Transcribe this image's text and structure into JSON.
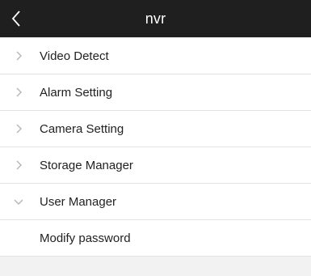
{
  "header": {
    "title": "nvr",
    "back_icon": "chevron-left-icon"
  },
  "menu": {
    "items": [
      {
        "label": "Video Detect",
        "icon": "chevron-right-icon",
        "expanded": false
      },
      {
        "label": "Alarm Setting",
        "icon": "chevron-right-icon",
        "expanded": false
      },
      {
        "label": "Camera Setting",
        "icon": "chevron-right-icon",
        "expanded": false
      },
      {
        "label": "Storage Manager",
        "icon": "chevron-right-icon",
        "expanded": false
      },
      {
        "label": "User Manager",
        "icon": "chevron-down-icon",
        "expanded": true
      }
    ],
    "subitems": [
      {
        "label": "Modify password"
      }
    ]
  },
  "colors": {
    "header_bg": "#1f1f1f",
    "chevron": "#b5b5b5",
    "divider": "#e2e2e2",
    "footer_bg": "#f2f2f2"
  }
}
